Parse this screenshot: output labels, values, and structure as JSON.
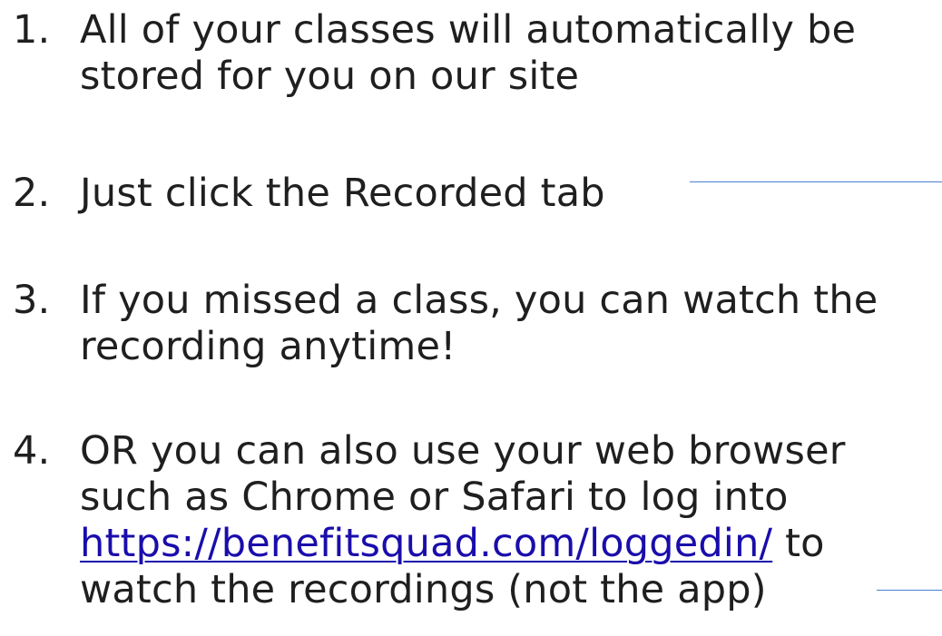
{
  "items": [
    {
      "number": "1.",
      "lines": [
        "All of your classes will automatically be",
        "stored for you on our site"
      ]
    },
    {
      "number": "2.",
      "lines": [
        "Just click the Recorded tab"
      ]
    },
    {
      "number": "3.",
      "lines": [
        "If you missed a class, you can watch the",
        "recording anytime!"
      ]
    },
    {
      "number": "4.",
      "lines": [
        "OR you can also use your web browser",
        "such as Chrome or Safari to log into"
      ],
      "link": "https://benefitsquad.com/loggedin/",
      "after_link": " to",
      "last_line": "watch the recordings (not the app)"
    }
  ],
  "colors": {
    "text": "#1f1f1f",
    "link": "#1a0dab",
    "rule": "#4a7fd4"
  }
}
